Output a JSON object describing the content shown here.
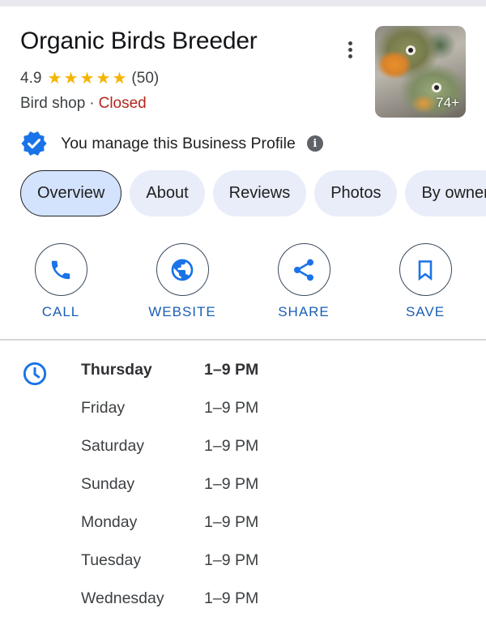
{
  "business": {
    "name": "Organic Birds Breeder",
    "rating": "4.9",
    "stars": [
      "★",
      "★",
      "★",
      "★",
      "★"
    ],
    "review_count": "(50)",
    "category": "Bird shop",
    "separator": "·",
    "status": "Closed",
    "photo_count": "74+",
    "manage_text": "You manage this Business Profile",
    "info_glyph": "i"
  },
  "colors": {
    "accent": "#1a73e8",
    "status_closed": "#b3261e",
    "star": "#f5b400",
    "tab_bg": "#e8edf9",
    "tab_active_bg": "#d3e3fd"
  },
  "tabs": [
    {
      "label": "Overview",
      "active": true
    },
    {
      "label": "About",
      "active": false
    },
    {
      "label": "Reviews",
      "active": false
    },
    {
      "label": "Photos",
      "active": false
    },
    {
      "label": "By owner",
      "active": false
    }
  ],
  "actions": [
    {
      "label": "CALL",
      "icon": "phone-icon"
    },
    {
      "label": "WEBSITE",
      "icon": "globe-icon"
    },
    {
      "label": "SHARE",
      "icon": "share-icon"
    },
    {
      "label": "SAVE",
      "icon": "bookmark-icon"
    }
  ],
  "hours": [
    {
      "day": "Thursday",
      "time": "1–9 PM",
      "today": true
    },
    {
      "day": "Friday",
      "time": "1–9 PM",
      "today": false
    },
    {
      "day": "Saturday",
      "time": "1–9 PM",
      "today": false
    },
    {
      "day": "Sunday",
      "time": "1–9 PM",
      "today": false
    },
    {
      "day": "Monday",
      "time": "1–9 PM",
      "today": false
    },
    {
      "day": "Tuesday",
      "time": "1–9 PM",
      "today": false
    },
    {
      "day": "Wednesday",
      "time": "1–9 PM",
      "today": false
    }
  ]
}
